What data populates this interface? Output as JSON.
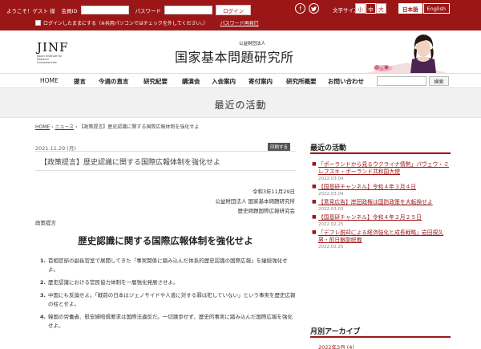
{
  "topbar": {
    "welcome": "ようこそ！ゲスト 様",
    "member_id_label": "会員ID",
    "password_label": "パスワード",
    "login_label": "ログイン",
    "remember_label": "ログインしたままにする（※共用パソコンではチェックを外してください。）",
    "reissue_label": "パスワード再発行",
    "font_size_label": "文字サイズ",
    "font_sizes": [
      "小",
      "中",
      "大"
    ],
    "languages": [
      "日本語",
      "English"
    ]
  },
  "header": {
    "logo_mark": "JINF",
    "logo_sub": "Japan Institute for National Fundamentals",
    "org_small": "公益財団法人",
    "org_name": "国家基本問題研究所"
  },
  "nav": {
    "items": [
      "HOME",
      "提言",
      "今週の直言",
      "研究紀要",
      "講演会",
      "入会案内",
      "寄付案内",
      "研究所概要",
      "お問い合わせ"
    ],
    "search_label": "検索"
  },
  "banner": {
    "title": "最近の活動"
  },
  "breadcrumb": {
    "home": "HOME",
    "sep1": "›",
    "news": "ニュース",
    "sep2": "›",
    "current": "【政策提言】歴史認識に関する国際広報体制を強化せよ"
  },
  "article": {
    "date": "2021.11.29 (月)",
    "print_label": "印刷する",
    "title": "【政策提言】歴史認識に関する国際広報体制を強化せよ",
    "sig_date": "令和3年11月29日",
    "sig_org": "公益財団法人 国家基本問題研究所",
    "sig_group": "歴史問題国際広報研究会",
    "category": "政策提言",
    "headline": "歴史認識に関する国際広報体制を強化せよ",
    "points": [
      {
        "num": "1.",
        "text": "首相官邸の副長官室で展開してきた「事実関係に踏み込んだ体系的歴史認識の国際広報」を継続強化せよ。"
      },
      {
        "num": "2.",
        "text": "歴史認識における官民協力体制を一層強化発展させよ。"
      },
      {
        "num": "3.",
        "text": "中国にも反論せよ。「戦前の日本はジェノサイドや人道に対する罪は犯していない」という事実を歴史広報の柱とせよ。"
      },
      {
        "num": "4.",
        "text": "韓国の労働者、慰安婦賠償要求は国際法違反だ。一切譲歩せず、歴史的事実に踏み込んだ国際広報を強化せよ。"
      }
    ]
  },
  "sidebar": {
    "title": "最近の活動",
    "items": [
      {
        "text": "「ポーランドから見るウクライナ情勢」パヴェウ・ミレフスキ・ポーランド共和国大使",
        "date": "2022.03.04"
      },
      {
        "text": "【国基研チャンネル】令和４年３月４日",
        "date": "2022.03.04"
      },
      {
        "text": "【意見広告】岸田政権は国防政策を大転換せよ",
        "date": "2022.03.03"
      },
      {
        "text": "【国基研チャンネル】令和４年２月２５日",
        "date": "2022.02.25"
      },
      {
        "text": "「デフレ脱却による経済強化と成長戦略」岩田規久男・前日銀副総裁",
        "date": "2022.02.25"
      }
    ],
    "archive_title": "月別アーカイブ",
    "archive_first": "2022年3月 (4)"
  }
}
